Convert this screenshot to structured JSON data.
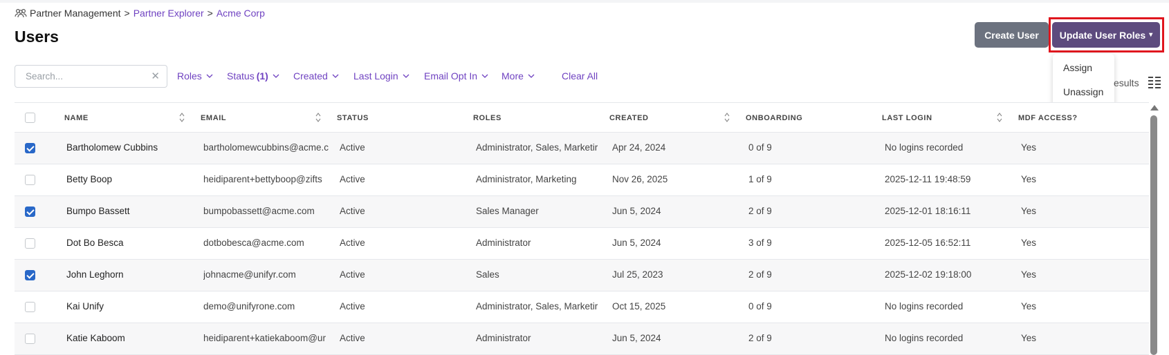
{
  "breadcrumb": {
    "root": "Partner Management",
    "separator": ">",
    "items": [
      "Partner Explorer",
      "Acme Corp"
    ],
    "icon": "people-icon"
  },
  "page_title": "Users",
  "toolbar": {
    "create_user_label": "Create User",
    "update_roles_label": "Update User Roles",
    "update_roles_caret": "▾"
  },
  "update_roles_menu": {
    "items": [
      "Assign",
      "Unassign"
    ]
  },
  "search": {
    "placeholder": "Search...",
    "value": "",
    "clear_icon": "close-icon"
  },
  "filters": {
    "roles": "Roles",
    "status": "Status",
    "status_count": "(1)",
    "created": "Created",
    "last_login": "Last Login",
    "email_opt_in": "Email Opt In",
    "more": "More",
    "clear_all": "Clear All"
  },
  "results_text": "esults",
  "table": {
    "columns": [
      "NAME",
      "EMAIL",
      "STATUS",
      "ROLES",
      "CREATED",
      "ONBOARDING",
      "LAST LOGIN",
      "MDF ACCESS?"
    ],
    "rows": [
      {
        "checked": true,
        "name": "Bartholomew Cubbins",
        "email": "bartholomewcubbins@acme.c",
        "status": "Active",
        "roles": "Administrator, Sales, Marketir",
        "created": "Apr 24, 2024",
        "onboarding": "0 of 9",
        "last_login": "No logins recorded",
        "mdf": "Yes"
      },
      {
        "checked": false,
        "name": "Betty Boop",
        "email": "heidiparent+bettyboop@zifts",
        "status": "Active",
        "roles": "Administrator, Marketing",
        "created": "Nov 26, 2025",
        "onboarding": "1 of 9",
        "last_login": "2025-12-11 19:48:59",
        "mdf": "Yes"
      },
      {
        "checked": true,
        "name": "Bumpo Bassett",
        "email": "bumpobassett@acme.com",
        "status": "Active",
        "roles": "Sales Manager",
        "created": "Jun 5, 2024",
        "onboarding": "2 of 9",
        "last_login": "2025-12-01 18:16:11",
        "mdf": "Yes"
      },
      {
        "checked": false,
        "name": "Dot Bo Besca",
        "email": "dotbobesca@acme.com",
        "status": "Active",
        "roles": "Administrator",
        "created": "Jun 5, 2024",
        "onboarding": "3 of 9",
        "last_login": "2025-12-05 16:52:11",
        "mdf": "Yes"
      },
      {
        "checked": true,
        "name": "John Leghorn",
        "email": "johnacme@unifyr.com",
        "status": "Active",
        "roles": "Sales",
        "created": "Jul 25, 2023",
        "onboarding": "2 of 9",
        "last_login": "2025-12-02 19:18:00",
        "mdf": "Yes"
      },
      {
        "checked": false,
        "name": "Kai Unify",
        "email": "demo@unifyrone.com",
        "status": "Active",
        "roles": "Administrator, Sales, Marketir",
        "created": "Oct 15, 2025",
        "onboarding": "0 of 9",
        "last_login": "No logins recorded",
        "mdf": "Yes"
      },
      {
        "checked": false,
        "name": "Katie Kaboom",
        "email": "heidiparent+katiekaboom@ur",
        "status": "Active",
        "roles": "Administrator",
        "created": "Jun 5, 2024",
        "onboarding": "2 of 9",
        "last_login": "No logins recorded",
        "mdf": "Yes"
      }
    ]
  },
  "colors": {
    "accent_purple": "#6f42c1",
    "primary_button": "#5d4b7e",
    "secondary_button": "#6c727f",
    "checkbox_checked": "#2968c8",
    "highlight": "#e0161e"
  }
}
